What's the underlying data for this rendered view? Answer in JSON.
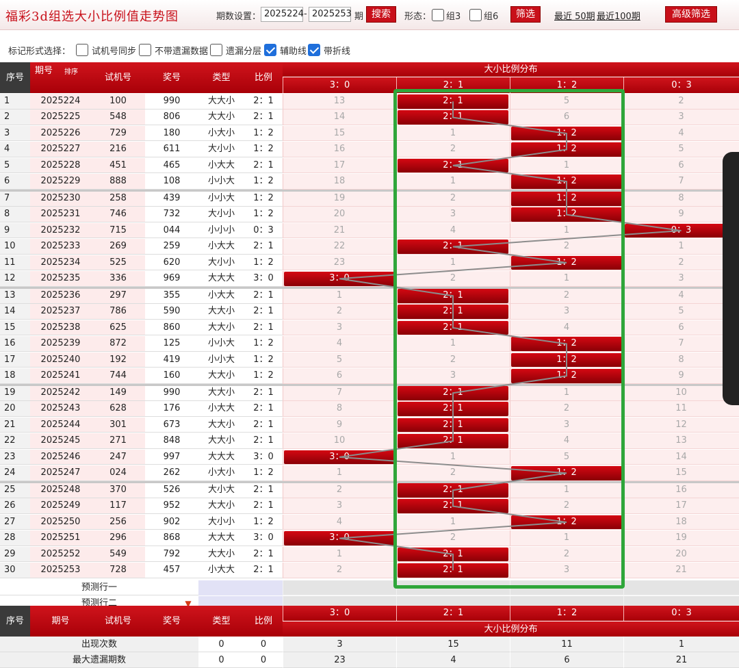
{
  "title": "福彩3d组选大小比例值走势图",
  "toolbar": {
    "period_label": "期数设置：",
    "from": "2025224",
    "dash": "-",
    "to": "2025253",
    "unit": "期",
    "search": "搜索",
    "shape_label": "形态：",
    "g3": "组3",
    "g6": "组6",
    "filter": "筛选",
    "recent50": "最近 50期",
    "recent100": "最近100期",
    "advanced": "高级筛选"
  },
  "options": {
    "label": "标记形式选择：",
    "items": [
      {
        "label": "试机号同步",
        "checked": false
      },
      {
        "label": "不带遗漏数据",
        "checked": false
      },
      {
        "label": "遗漏分层",
        "checked": false
      },
      {
        "label": "辅助线",
        "checked": true
      },
      {
        "label": "带折线",
        "checked": true
      }
    ]
  },
  "headers": {
    "seq": "序号",
    "period": "期号",
    "sort": "排序",
    "test": "试机号",
    "prize": "奖号",
    "type": "类型",
    "ratio": "比例",
    "dist": "大小比例分布"
  },
  "categories": [
    "3：0",
    "2：1",
    "1：2",
    "0：3"
  ],
  "rows": [
    {
      "s": "1",
      "p": "2025224",
      "t": "100",
      "n": "990",
      "k": "大大小",
      "r": "2：1",
      "c": 1,
      "m": [
        "13",
        "",
        "5",
        "2"
      ]
    },
    {
      "s": "2",
      "p": "2025225",
      "t": "548",
      "n": "806",
      "k": "大大小",
      "r": "2：1",
      "c": 1,
      "m": [
        "14",
        "",
        "6",
        "3"
      ]
    },
    {
      "s": "3",
      "p": "2025226",
      "t": "729",
      "n": "180",
      "k": "小大小",
      "r": "1：2",
      "c": 2,
      "m": [
        "15",
        "1",
        "",
        "4"
      ]
    },
    {
      "s": "4",
      "p": "2025227",
      "t": "216",
      "n": "611",
      "k": "大小小",
      "r": "1：2",
      "c": 2,
      "m": [
        "16",
        "2",
        "",
        "5"
      ]
    },
    {
      "s": "5",
      "p": "2025228",
      "t": "451",
      "n": "465",
      "k": "小大大",
      "r": "2：1",
      "c": 1,
      "m": [
        "17",
        "",
        "1",
        "6"
      ]
    },
    {
      "s": "6",
      "p": "2025229",
      "t": "888",
      "n": "108",
      "k": "小小大",
      "r": "1：2",
      "c": 2,
      "m": [
        "18",
        "1",
        "",
        "7"
      ]
    },
    {
      "s": "7",
      "p": "2025230",
      "t": "258",
      "n": "439",
      "k": "小小大",
      "r": "1：2",
      "c": 2,
      "m": [
        "19",
        "2",
        "",
        "8"
      ]
    },
    {
      "s": "8",
      "p": "2025231",
      "t": "746",
      "n": "732",
      "k": "大小小",
      "r": "1：2",
      "c": 2,
      "m": [
        "20",
        "3",
        "",
        "9"
      ]
    },
    {
      "s": "9",
      "p": "2025232",
      "t": "715",
      "n": "044",
      "k": "小小小",
      "r": "0：3",
      "c": 3,
      "m": [
        "21",
        "4",
        "1",
        ""
      ]
    },
    {
      "s": "10",
      "p": "2025233",
      "t": "269",
      "n": "259",
      "k": "小大大",
      "r": "2：1",
      "c": 1,
      "m": [
        "22",
        "",
        "2",
        "1"
      ]
    },
    {
      "s": "11",
      "p": "2025234",
      "t": "525",
      "n": "620",
      "k": "大小小",
      "r": "1：2",
      "c": 2,
      "m": [
        "23",
        "1",
        "",
        "2"
      ]
    },
    {
      "s": "12",
      "p": "2025235",
      "t": "336",
      "n": "969",
      "k": "大大大",
      "r": "3：0",
      "c": 0,
      "m": [
        "",
        "2",
        "1",
        "3"
      ]
    },
    {
      "s": "13",
      "p": "2025236",
      "t": "297",
      "n": "355",
      "k": "小大大",
      "r": "2：1",
      "c": 1,
      "m": [
        "1",
        "",
        "2",
        "4"
      ]
    },
    {
      "s": "14",
      "p": "2025237",
      "t": "786",
      "n": "590",
      "k": "大大小",
      "r": "2：1",
      "c": 1,
      "m": [
        "2",
        "",
        "3",
        "5"
      ]
    },
    {
      "s": "15",
      "p": "2025238",
      "t": "625",
      "n": "860",
      "k": "大大小",
      "r": "2：1",
      "c": 1,
      "m": [
        "3",
        "",
        "4",
        "6"
      ]
    },
    {
      "s": "16",
      "p": "2025239",
      "t": "872",
      "n": "125",
      "k": "小小大",
      "r": "1：2",
      "c": 2,
      "m": [
        "4",
        "1",
        "",
        "7"
      ]
    },
    {
      "s": "17",
      "p": "2025240",
      "t": "192",
      "n": "419",
      "k": "小小大",
      "r": "1：2",
      "c": 2,
      "m": [
        "5",
        "2",
        "",
        "8"
      ]
    },
    {
      "s": "18",
      "p": "2025241",
      "t": "744",
      "n": "160",
      "k": "大大小",
      "r": "1：2",
      "c": 2,
      "m": [
        "6",
        "3",
        "",
        "9"
      ]
    },
    {
      "s": "19",
      "p": "2025242",
      "t": "149",
      "n": "990",
      "k": "大大小",
      "r": "2：1",
      "c": 1,
      "m": [
        "7",
        "",
        "1",
        "10"
      ]
    },
    {
      "s": "20",
      "p": "2025243",
      "t": "628",
      "n": "176",
      "k": "小大大",
      "r": "2：1",
      "c": 1,
      "m": [
        "8",
        "",
        "2",
        "11"
      ]
    },
    {
      "s": "21",
      "p": "2025244",
      "t": "301",
      "n": "673",
      "k": "大大小",
      "r": "2：1",
      "c": 1,
      "m": [
        "9",
        "",
        "3",
        "12"
      ]
    },
    {
      "s": "22",
      "p": "2025245",
      "t": "271",
      "n": "848",
      "k": "大大小",
      "r": "2：1",
      "c": 1,
      "m": [
        "10",
        "",
        "4",
        "13"
      ]
    },
    {
      "s": "23",
      "p": "2025246",
      "t": "247",
      "n": "997",
      "k": "大大大",
      "r": "3：0",
      "c": 0,
      "m": [
        "",
        "1",
        "5",
        "14"
      ]
    },
    {
      "s": "24",
      "p": "2025247",
      "t": "024",
      "n": "262",
      "k": "小大小",
      "r": "1：2",
      "c": 2,
      "m": [
        "1",
        "2",
        "",
        "15"
      ]
    },
    {
      "s": "25",
      "p": "2025248",
      "t": "370",
      "n": "526",
      "k": "大小大",
      "r": "2：1",
      "c": 1,
      "m": [
        "2",
        "",
        "1",
        "16"
      ]
    },
    {
      "s": "26",
      "p": "2025249",
      "t": "117",
      "n": "952",
      "k": "大大小",
      "r": "2：1",
      "c": 1,
      "m": [
        "3",
        "",
        "2",
        "17"
      ]
    },
    {
      "s": "27",
      "p": "2025250",
      "t": "256",
      "n": "902",
      "k": "大小小",
      "r": "1：2",
      "c": 2,
      "m": [
        "4",
        "1",
        "",
        "18"
      ]
    },
    {
      "s": "28",
      "p": "2025251",
      "t": "296",
      "n": "868",
      "k": "大大大",
      "r": "3：0",
      "c": 0,
      "m": [
        "",
        "2",
        "1",
        "19"
      ]
    },
    {
      "s": "29",
      "p": "2025252",
      "t": "549",
      "n": "792",
      "k": "大大小",
      "r": "2：1",
      "c": 1,
      "m": [
        "1",
        "",
        "2",
        "20"
      ]
    },
    {
      "s": "30",
      "p": "2025253",
      "t": "728",
      "n": "457",
      "k": "小大大",
      "r": "2：1",
      "c": 1,
      "m": [
        "2",
        "",
        "3",
        "21"
      ]
    }
  ],
  "predict": [
    "预测行一",
    "预测行二"
  ],
  "stats": [
    {
      "label": "出现次数",
      "v": [
        "0",
        "0",
        "3",
        "15",
        "11",
        "1"
      ]
    },
    {
      "label": "最大遗漏期数",
      "v": [
        "0",
        "0",
        "23",
        "4",
        "6",
        "21"
      ]
    }
  ]
}
